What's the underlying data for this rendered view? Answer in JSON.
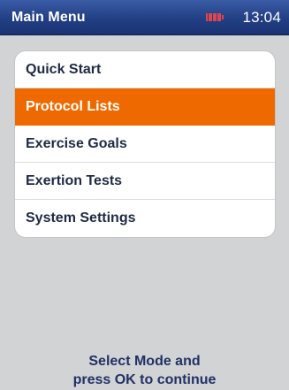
{
  "header": {
    "title": "Main Menu",
    "time": "13:04",
    "battery_icon": "battery-icon",
    "battery_color": "#e0454a",
    "bar_color": "#223f84"
  },
  "menu": {
    "items": [
      {
        "label": "Quick Start",
        "selected": false
      },
      {
        "label": "Protocol Lists",
        "selected": true
      },
      {
        "label": "Exercise Goals",
        "selected": false
      },
      {
        "label": "Exertion Tests",
        "selected": false
      },
      {
        "label": "System Settings",
        "selected": false
      }
    ],
    "selected_color": "#ee6a00"
  },
  "footer": {
    "line1": "Select Mode and",
    "line2": "press OK to continue"
  }
}
